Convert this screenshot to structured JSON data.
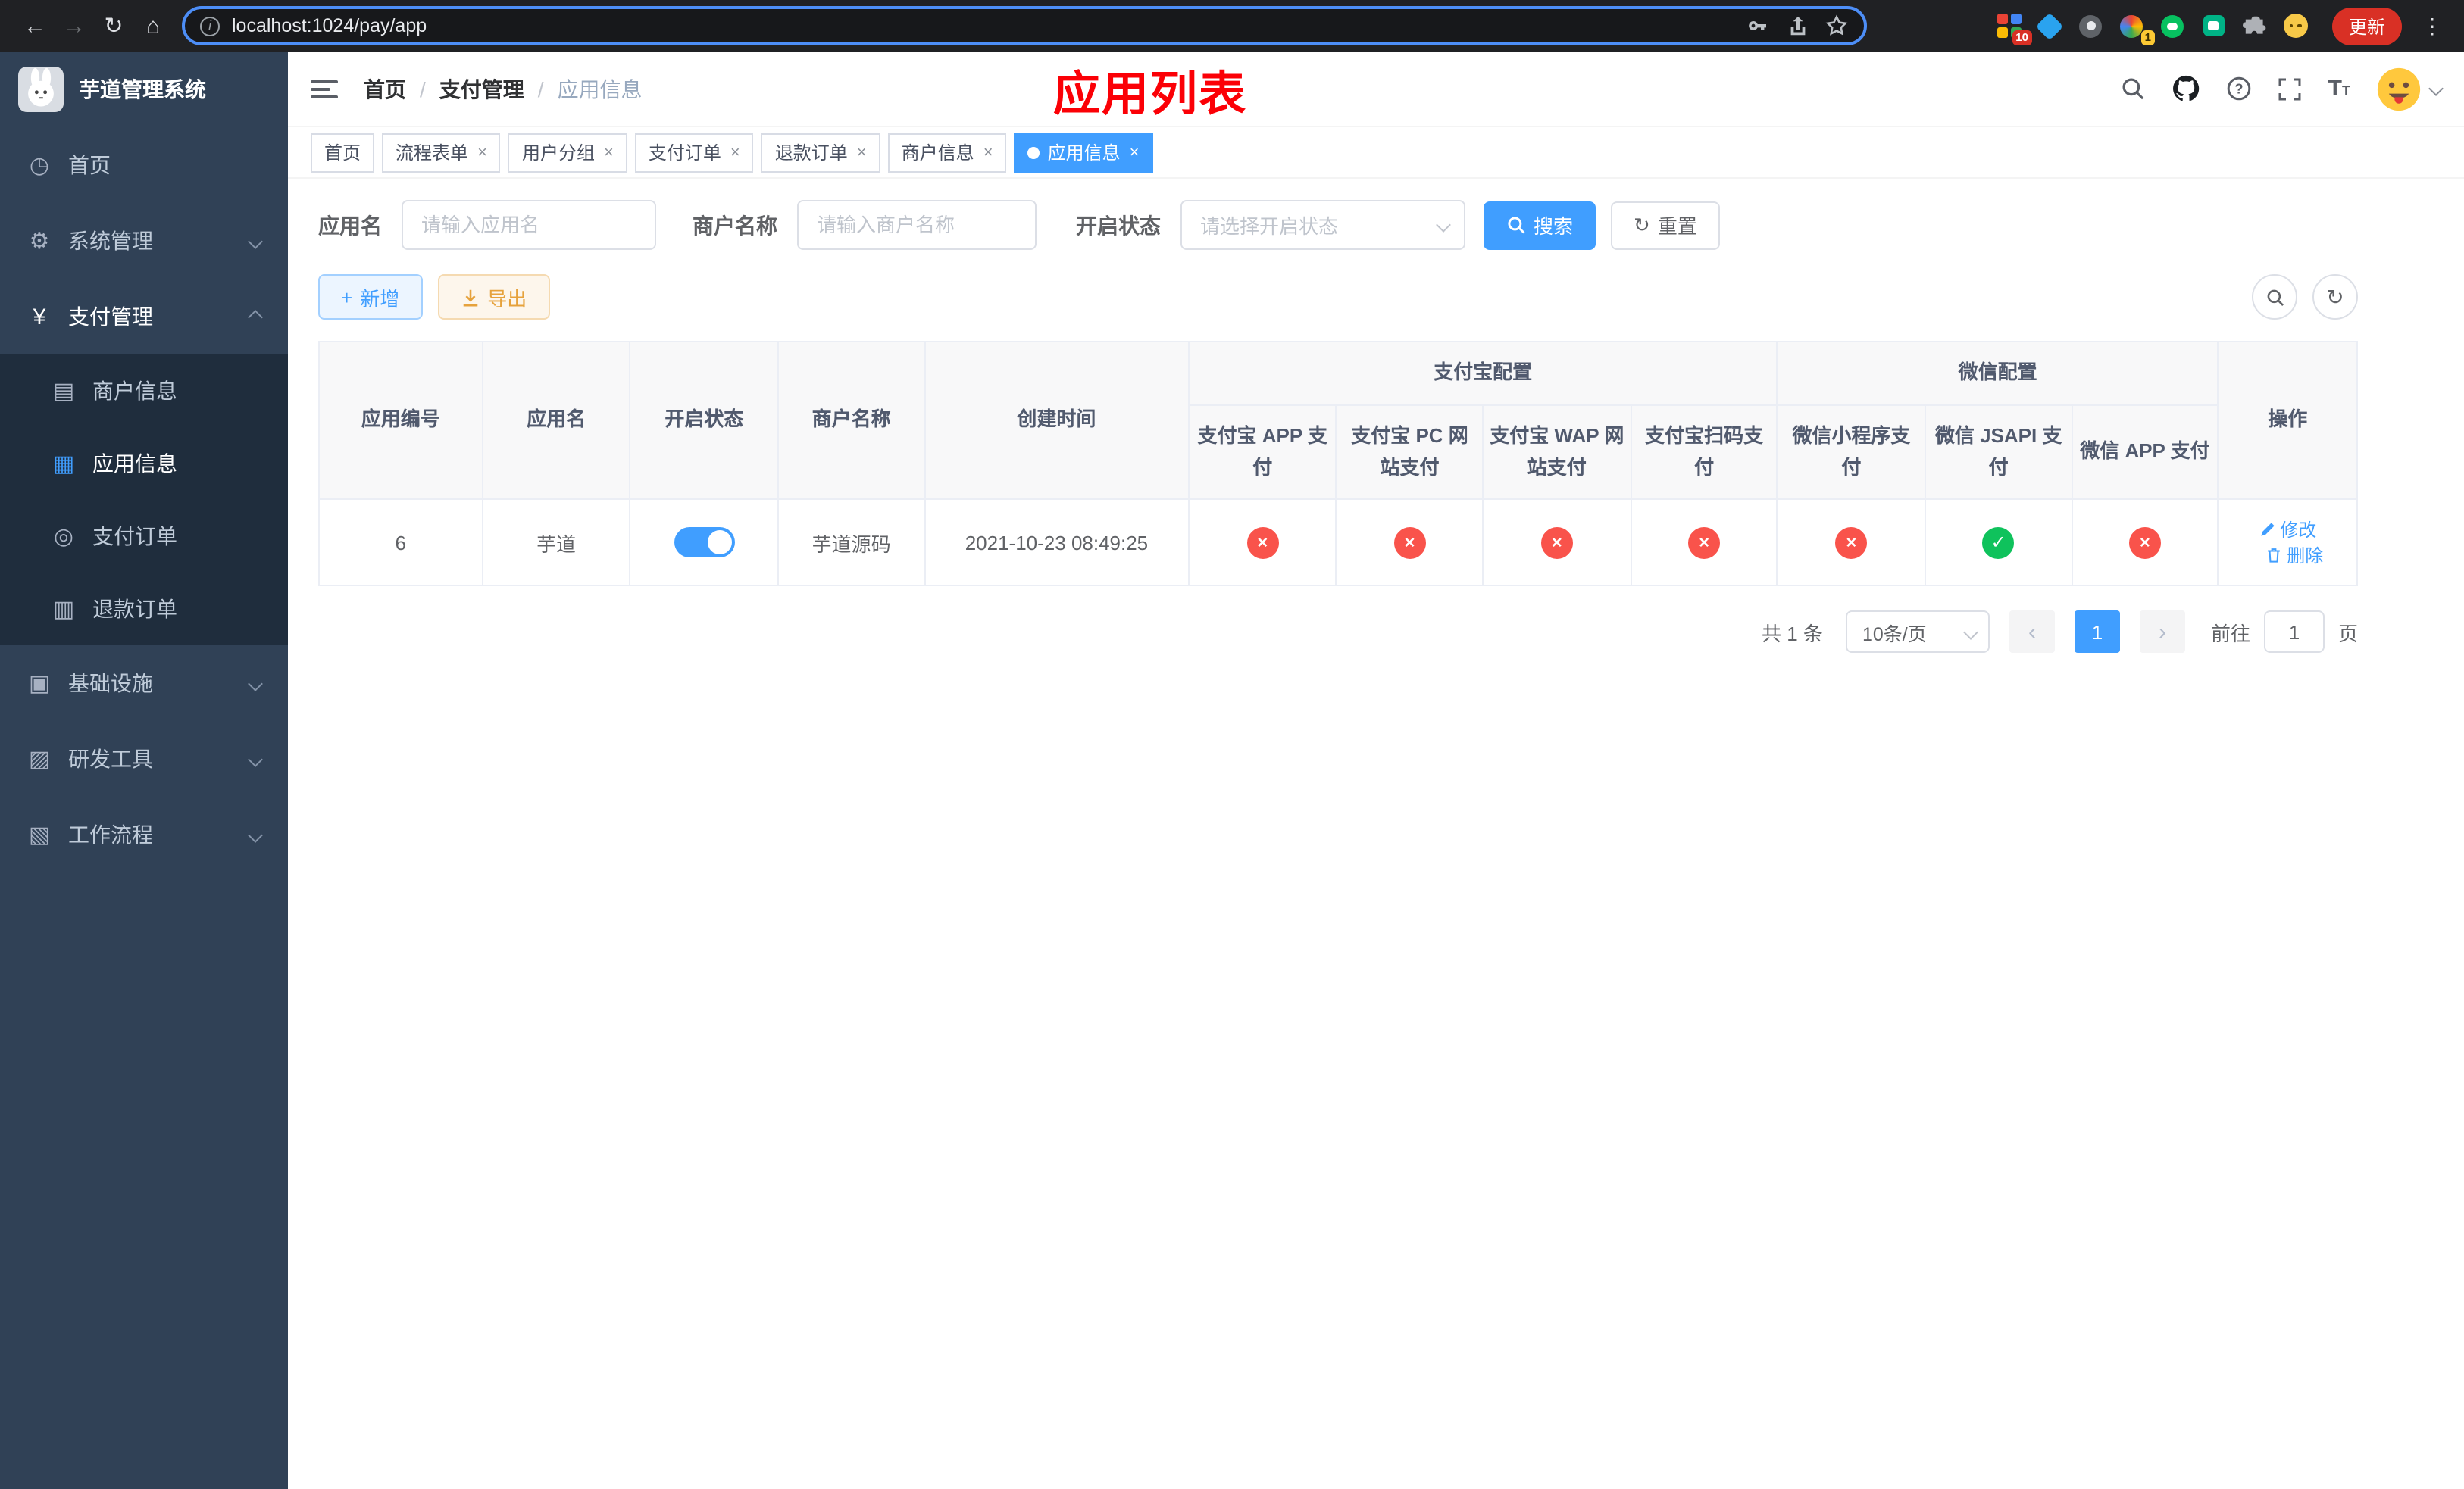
{
  "browser": {
    "url": "localhost:1024/pay/app",
    "update_button": "更新",
    "extension_badges": {
      "grid": "10",
      "colorful": "1"
    }
  },
  "sidebar": {
    "app_title": "芋道管理系统",
    "menu": [
      {
        "label": "首页"
      },
      {
        "label": "系统管理"
      },
      {
        "label": "支付管理"
      },
      {
        "label": "基础设施"
      },
      {
        "label": "研发工具"
      },
      {
        "label": "工作流程"
      }
    ],
    "submenu": [
      {
        "label": "商户信息"
      },
      {
        "label": "应用信息"
      },
      {
        "label": "支付订单"
      },
      {
        "label": "退款订单"
      }
    ]
  },
  "header": {
    "breadcrumb": [
      "首页",
      "支付管理",
      "应用信息"
    ],
    "annotation": "应用列表"
  },
  "tabs": [
    {
      "label": "首页",
      "closable": false,
      "active": false
    },
    {
      "label": "流程表单",
      "closable": true,
      "active": false
    },
    {
      "label": "用户分组",
      "closable": true,
      "active": false
    },
    {
      "label": "支付订单",
      "closable": true,
      "active": false
    },
    {
      "label": "退款订单",
      "closable": true,
      "active": false
    },
    {
      "label": "商户信息",
      "closable": true,
      "active": false
    },
    {
      "label": "应用信息",
      "closable": true,
      "active": true
    }
  ],
  "filters": {
    "app_name_label": "应用名",
    "app_name_placeholder": "请输入应用名",
    "merchant_label": "商户名称",
    "merchant_placeholder": "请输入商户名称",
    "status_label": "开启状态",
    "status_placeholder": "请选择开启状态",
    "search_button": "搜索",
    "reset_button": "重置"
  },
  "toolbar": {
    "add_button": "新增",
    "export_button": "导出"
  },
  "table": {
    "columns": {
      "app_id": "应用编号",
      "app_name": "应用名",
      "status": "开启状态",
      "merchant": "商户名称",
      "created": "创建时间",
      "alipay_group": "支付宝配置",
      "alipay_cols": [
        "支付宝 APP 支付",
        "支付宝 PC 网站支付",
        "支付宝 WAP 网站支付",
        "支付宝扫码支付"
      ],
      "wechat_group": "微信配置",
      "wechat_cols": [
        "微信小程序支付",
        "微信 JSAPI 支付",
        "微信 APP 支付"
      ],
      "actions": "操作"
    },
    "rows": [
      {
        "app_id": "6",
        "app_name": "芋道",
        "enabled": true,
        "merchant": "芋道源码",
        "created": "2021-10-23 08:49:25",
        "channels": [
          false,
          false,
          false,
          false,
          false,
          true,
          false
        ],
        "edit_label": "修改",
        "delete_label": "删除"
      }
    ]
  },
  "pagination": {
    "total": "共 1 条",
    "page_size": "10条/页",
    "current_page": "1",
    "goto_label": "前往",
    "goto_value": "1",
    "page_unit": "页"
  },
  "colors": {
    "primary": "#409eff",
    "danger": "#f9534b",
    "success": "#0fc25c",
    "sidebar_bg": "#304156",
    "submenu_bg": "#1f2d3d",
    "annotation_red": "#fb0006"
  }
}
